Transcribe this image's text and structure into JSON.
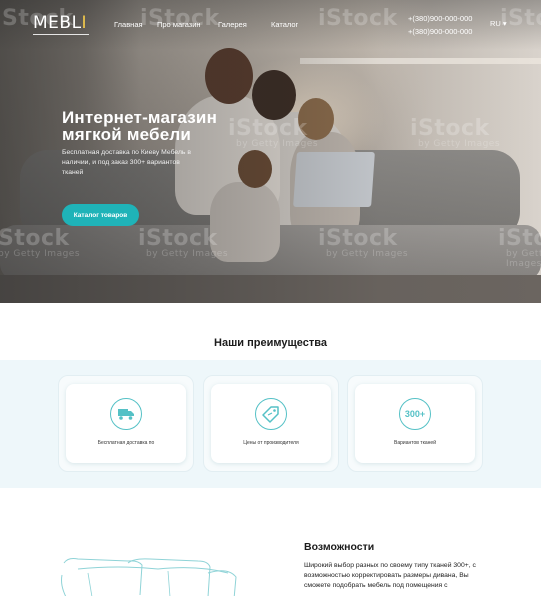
{
  "brand": {
    "logo_main": "MEBL",
    "logo_accent": "I",
    "accent_color": "#1fb3b8"
  },
  "nav": {
    "items": [
      "Главная",
      "Про магазин",
      "Галерея",
      "Каталог"
    ]
  },
  "phones": [
    "+(380)900-000-000",
    "+(380)900-000-000"
  ],
  "language": "RU ▾",
  "hero": {
    "title": "Интернет-магазин мягкой мебели",
    "subtitle": "Бесплатная доставка по Киеву Мебель в наличии, и под заказ 300+ вариантов тканей",
    "button": "Каталог товаров",
    "watermarks": [
      "iStock",
      "by Getty Images"
    ]
  },
  "advantages": {
    "title": "Наши преимущества",
    "items": [
      {
        "icon": "delivery-truck-icon",
        "label": "Бесплатная доставка по"
      },
      {
        "icon": "price-tag-icon",
        "label": "Цены от производителя"
      },
      {
        "icon": "fabric-count-icon",
        "icon_text": "300+",
        "label": "Вариантов тканей"
      }
    ]
  },
  "features": {
    "title": "Возможности",
    "text": "Широкий выбор разных по своему типу тканей 300+, с возможностью корректировать размеры дивана, Вы сможете подобрать мебель под помещения с"
  }
}
